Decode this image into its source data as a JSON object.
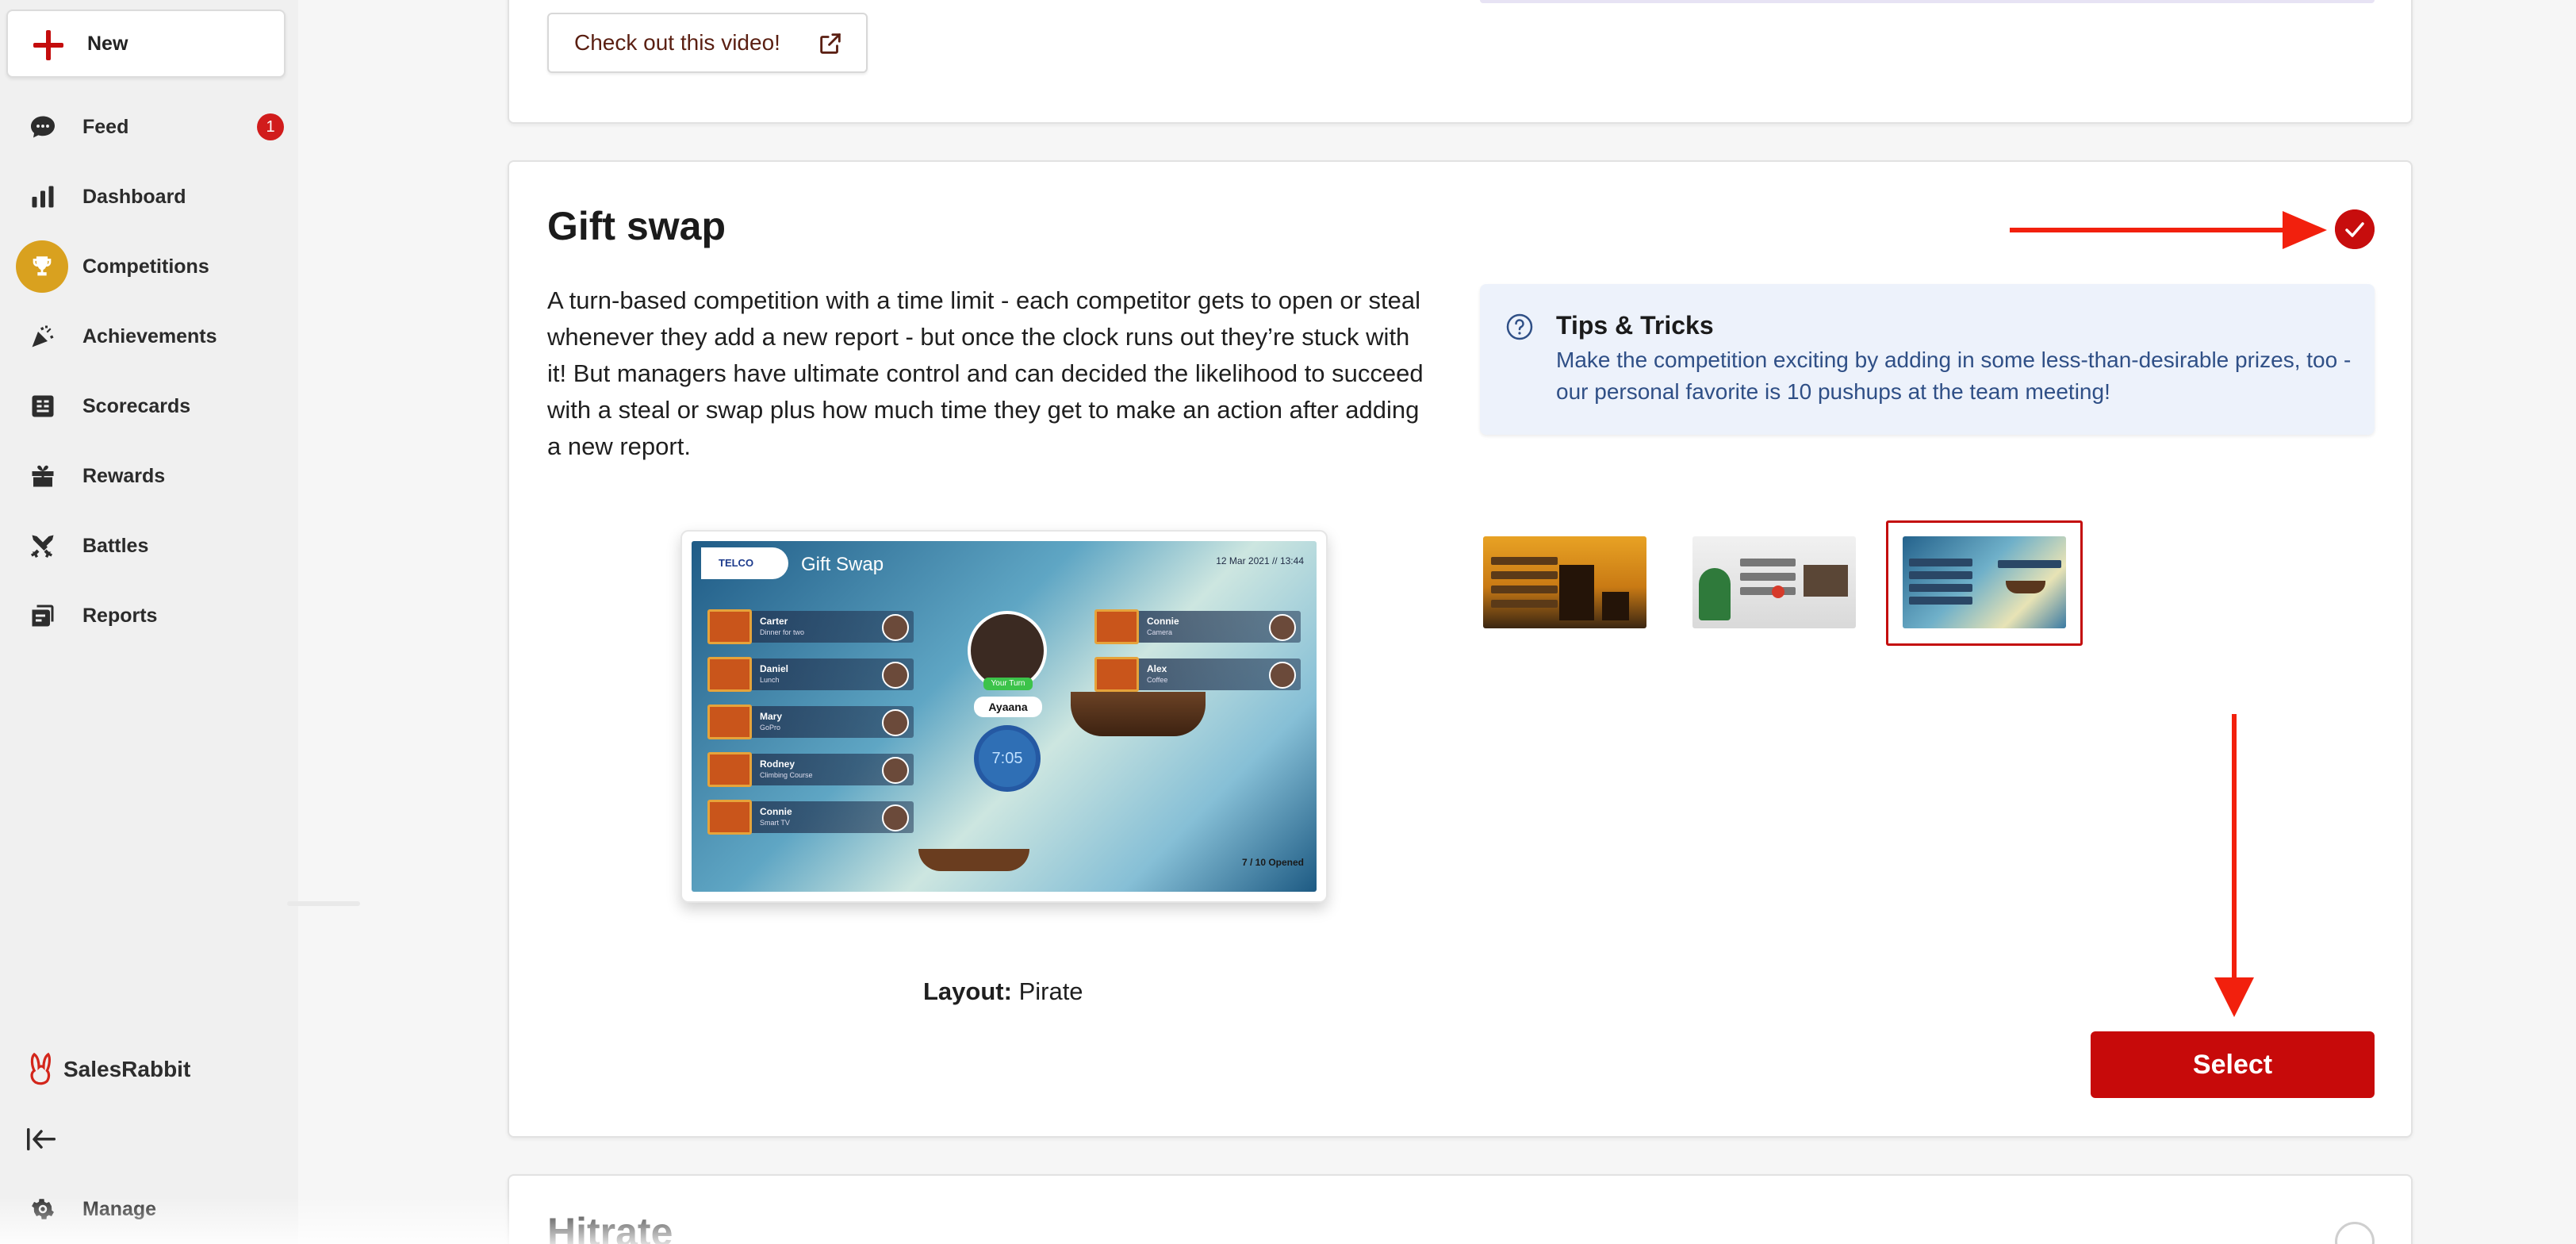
{
  "sidebar": {
    "new_label": "New",
    "items": [
      {
        "label": "Feed",
        "icon": "chat-bubble-icon",
        "badge": "1"
      },
      {
        "label": "Dashboard",
        "icon": "bar-chart-icon"
      },
      {
        "label": "Competitions",
        "icon": "trophy-icon",
        "active": true
      },
      {
        "label": "Achievements",
        "icon": "party-popper-icon"
      },
      {
        "label": "Scorecards",
        "icon": "scorecard-icon"
      },
      {
        "label": "Rewards",
        "icon": "gift-icon"
      },
      {
        "label": "Battles",
        "icon": "crossed-swords-icon"
      },
      {
        "label": "Reports",
        "icon": "reports-icon"
      }
    ],
    "brand_name": "SalesRabbit",
    "manage_label": "Manage"
  },
  "top_card": {
    "video_button_label": "Check out this video!"
  },
  "gift_swap": {
    "title": "Gift swap",
    "description": "A turn-based competition with a time limit - each competitor gets to open or steal whenever they add a new report - but once the clock runs out they’re stuck with it! But managers have ultimate control and can decided the likelihood to succeed with a steal or swap plus how much time they get to make an action after adding a new report.",
    "tips": {
      "title": "Tips & Tricks",
      "body": "Make the competition exciting by adding in some less-than-desirable prizes, too - our personal favorite is 10 pushups at the team meeting!"
    },
    "preview": {
      "logo": "TELCO",
      "title": "Gift Swap",
      "date": "12 Mar 2021  //  13:44",
      "competitors": [
        {
          "name": "Carter",
          "prize": "Dinner for two"
        },
        {
          "name": "Daniel",
          "prize": "Lunch"
        },
        {
          "name": "Mary",
          "prize": "GoPro"
        },
        {
          "name": "Rodney",
          "prize": "Climbing Course"
        },
        {
          "name": "Connie",
          "prize": "Smart TV"
        }
      ],
      "right_competitors": [
        {
          "name": "Connie",
          "prize": "Camera"
        },
        {
          "name": "Alex",
          "prize": "Coffee"
        }
      ],
      "your_turn": "Your Turn",
      "current_player": "Ayaana",
      "timer": "7:05",
      "opened": "7 / 10 Opened"
    },
    "layout_label": "Layout:",
    "layout_value": "Pirate",
    "select_label": "Select",
    "selected": true
  },
  "next_card": {
    "title": "Hitrate"
  },
  "colors": {
    "brand_red": "#c70a0a",
    "annotation_arrow": "#f2200d",
    "trophy_gold": "#d9a11f",
    "tips_bg": "#edf2fb",
    "tips_text": "#2f4f86"
  }
}
